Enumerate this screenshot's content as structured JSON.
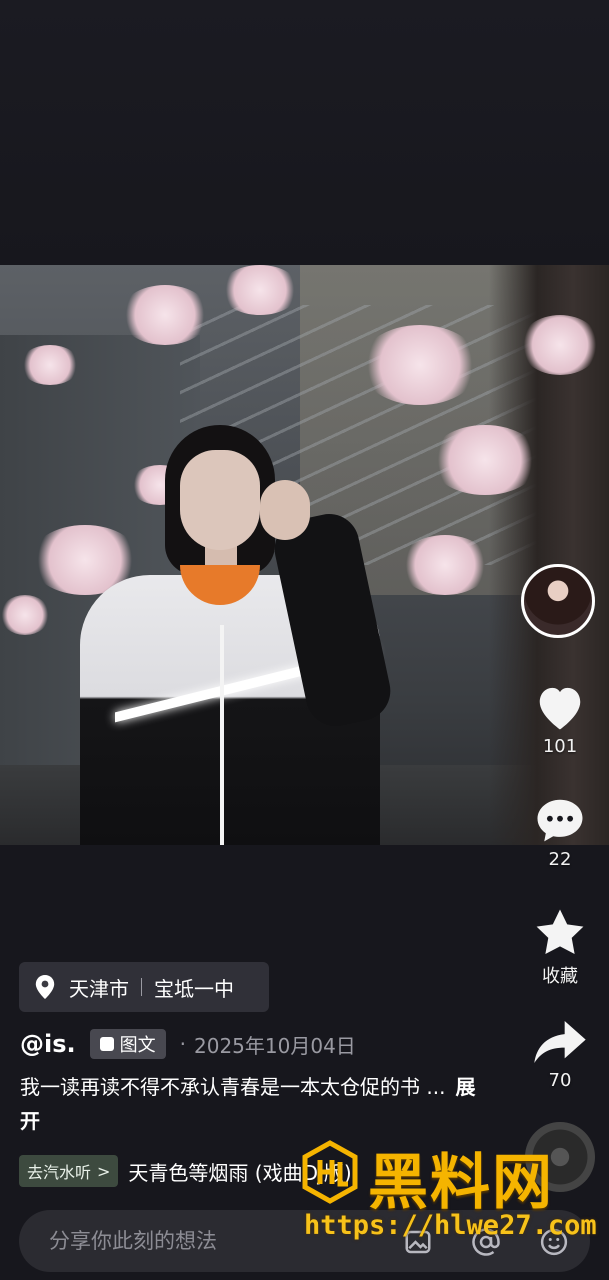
{
  "post": {
    "location": {
      "city": "天津市",
      "place": "宝坻一中"
    },
    "author": "@is.",
    "type_badge": "图文",
    "separator": "·",
    "date": "2025年10月04日",
    "caption": "我一读再读不得不承认青春是一本太仓促的书 ...",
    "expand_label": "展开"
  },
  "rail": {
    "likes": "101",
    "comments": "22",
    "favorite_label": "收藏",
    "shares": "70"
  },
  "music": {
    "go_listen_label": "去汽水听",
    "go_listen_chevron": ">",
    "song_title": "天青色等烟雨 (戏曲DJ版)"
  },
  "comment_bar": {
    "placeholder": "分享你此刻的想法"
  },
  "watermark": {
    "title": "黑料网",
    "url": "https://hlwe27.com"
  },
  "colors": {
    "background": "#17171d",
    "badge_bg": "#4a4a52",
    "watermark": "#f5b400"
  },
  "icons": [
    "location-pin-icon",
    "doc-icon",
    "heart-icon",
    "comment-icon",
    "star-icon",
    "share-icon",
    "image-icon",
    "at-icon",
    "emoji-icon"
  ]
}
